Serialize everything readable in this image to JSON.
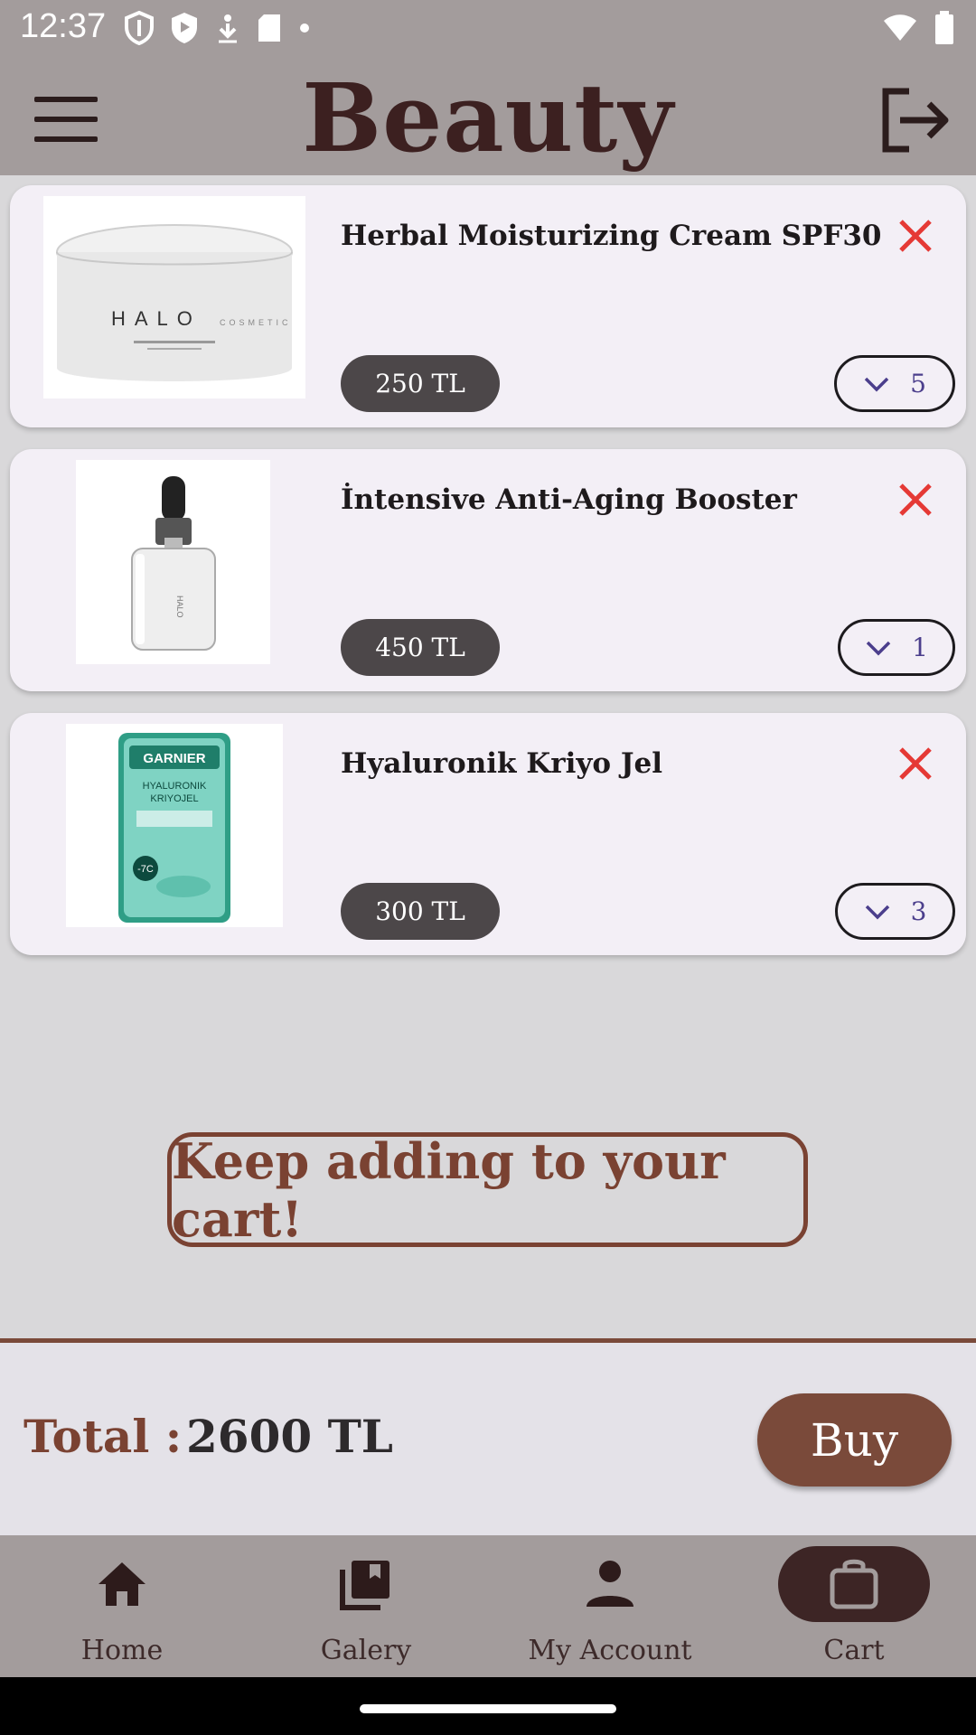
{
  "status_bar": {
    "time": "12:37",
    "icons_left": [
      "shield-outline-icon",
      "shield-filled-icon",
      "download-icon",
      "sd-card-icon",
      "dot-icon"
    ],
    "icons_right": [
      "wifi-icon",
      "battery-icon"
    ]
  },
  "app_bar": {
    "title": "Beauty",
    "menu_icon": "hamburger-menu-icon",
    "logout_icon": "logout-icon"
  },
  "cart_items": [
    {
      "name": "Herbal Moisturizing Cream SPF30",
      "price": "250 TL",
      "quantity": "5",
      "image": "halo-cosmetic-cream-jar"
    },
    {
      "name": "İntensive Anti-Aging Booster",
      "price": "450 TL",
      "quantity": "1",
      "image": "serum-dropper-bottle"
    },
    {
      "name": "Hyaluronik Kriyo Jel",
      "price": "300 TL",
      "quantity": "3",
      "image": "garnier-eye-mask-pack"
    }
  ],
  "keep_adding": "Keep adding to your cart!",
  "total": {
    "label": "Total :",
    "value": "2600 TL"
  },
  "buy_label": "Buy",
  "bottom_nav": [
    {
      "label": "Home",
      "icon": "home-icon",
      "active": false
    },
    {
      "label": "Galery",
      "icon": "gallery-icon",
      "active": false
    },
    {
      "label": "My Account",
      "icon": "person-icon",
      "active": false
    },
    {
      "label": "Cart",
      "icon": "shopping-bag-icon",
      "active": true
    }
  ],
  "colors": {
    "app_bar": "#a39c9c",
    "accent_brown": "#7a4a3a",
    "remove_red": "#e53935",
    "price_pill": "#4c4749",
    "nav_active": "#3d2525"
  }
}
